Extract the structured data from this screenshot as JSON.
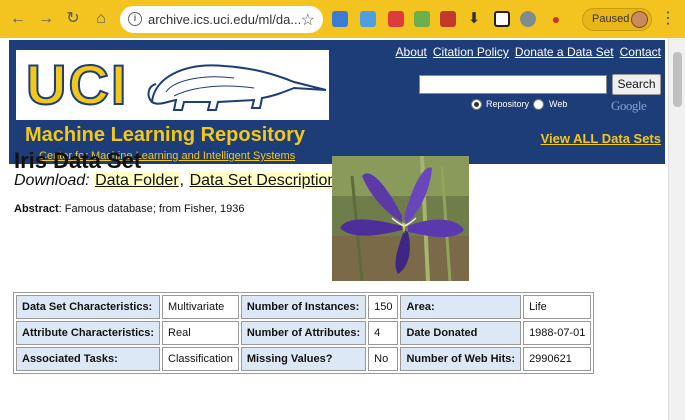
{
  "browser": {
    "url": "archive.ics.uci.edu/ml/da...",
    "profile_status": "Paused"
  },
  "header": {
    "logo_text": "UCI",
    "title": "Machine Learning Repository",
    "subtitle": "Center for Machine Learning and Intelligent Systems",
    "links": [
      "About",
      "Citation Policy",
      "Donate a Data Set",
      "Contact"
    ],
    "search_button": "Search",
    "search_value": "",
    "radio_repository": "Repository",
    "radio_web": "Web",
    "google_label": "Google",
    "view_all": "View ALL Data Sets"
  },
  "dataset": {
    "title": "Iris Data Set",
    "download_label": "Download",
    "download_links": [
      "Data Folder",
      "Data Set Description"
    ],
    "abstract_label": "Abstract",
    "abstract_text": ": Famous database; from Fisher, 1936"
  },
  "info_table": {
    "rows": [
      [
        "Data Set Characteristics:",
        "Multivariate",
        "Number of Instances:",
        "150",
        "Area:",
        "Life"
      ],
      [
        "Attribute Characteristics:",
        "Real",
        "Number of Attributes:",
        "4",
        "Date Donated",
        "1988-07-01"
      ],
      [
        "Associated Tasks:",
        "Classification",
        "Missing Values?",
        "No",
        "Number of Web Hits:",
        "2990621"
      ]
    ]
  },
  "colors": {
    "chrome": "#f3c41f",
    "banner": "#1d3d78",
    "brand_yellow": "#f2c81a",
    "link_highlight": "#ffffc6",
    "table_header": "#dde8f6"
  },
  "icons": [
    "back-icon",
    "forward-icon",
    "reload-icon",
    "home-icon",
    "info-icon",
    "star-icon",
    "menu-dots-icon"
  ]
}
